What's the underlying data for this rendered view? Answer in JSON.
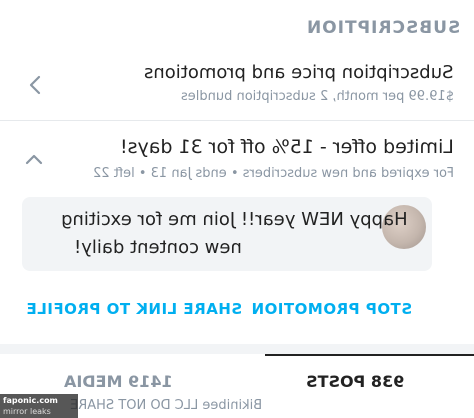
{
  "section": {
    "title": "SUBSCRIPTION"
  },
  "price": {
    "title": "Subscription price and promotions",
    "subtitle": "$19.99 per month, 2 subscription bundles"
  },
  "offer": {
    "title": "Limited offer - 15% off for 31 days!",
    "subtitle": "For expired and new subscribers • ends Jan 13 • left 22"
  },
  "message": {
    "line1": "Happy NEW year!! Join me for exciting",
    "line2": "new content daily!"
  },
  "actions": {
    "share_label": "SHARE LINK TO PROFILE",
    "stop_label": "STOP PROMOTION"
  },
  "tabs": {
    "posts_label": "938 POSTS",
    "media_label": "1419 MEDIA"
  },
  "footer": {
    "caption": "Bikinibee LLC DO NOT SHARE"
  },
  "watermark": {
    "brand": "faponic.com",
    "sub": "mirror leaks"
  },
  "colors": {
    "accent": "#00aff0",
    "muted": "#8a96a3",
    "text": "#222222"
  }
}
